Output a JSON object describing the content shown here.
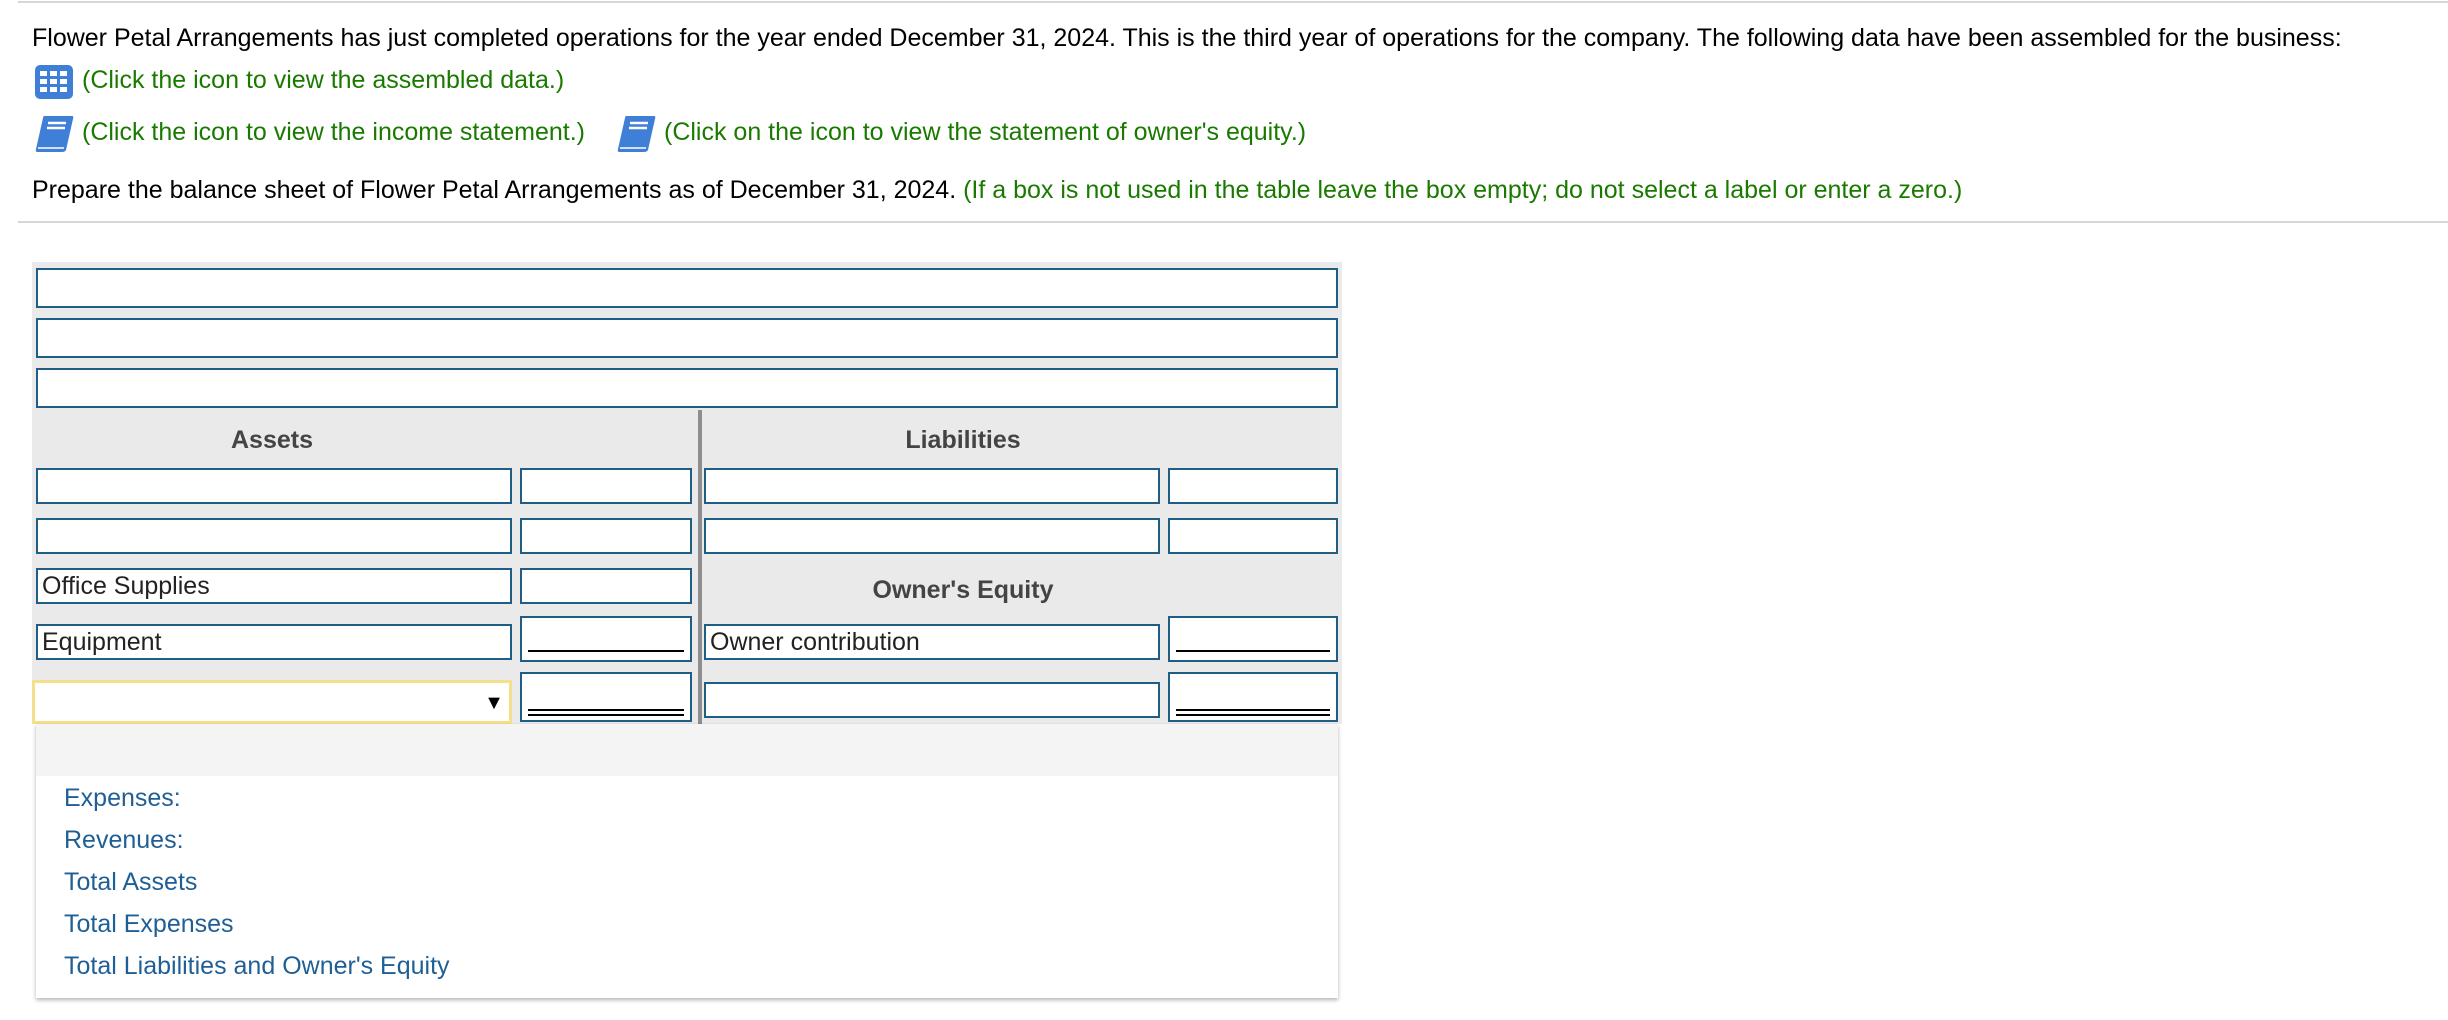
{
  "intro": {
    "text": "Flower Petal Arrangements has just completed operations for the year ended December 31, 2024. This is the third year of operations for the company. The following data have been assembled for the business:",
    "data_link": "(Click the icon to view the assembled data.)",
    "income_link": "(Click the icon to view the income statement.)",
    "equity_link": "(Click on the icon to view the statement of owner's equity.)"
  },
  "instruction": {
    "text": "Prepare the balance sheet of Flower Petal Arrangements as of December 31, 2024.",
    "note": "(If a box is not used in the table leave the box empty; do not select a label or enter a zero.)"
  },
  "table": {
    "header_rows": [
      "",
      "",
      ""
    ],
    "assets_header": "Assets",
    "liabilities_header": "Liabilities",
    "equity_header": "Owner's Equity",
    "assets": [
      {
        "label": "",
        "amount": ""
      },
      {
        "label": "",
        "amount": ""
      },
      {
        "label": "Office Supplies",
        "amount": ""
      },
      {
        "label": "Equipment",
        "amount": ""
      }
    ],
    "liabilities": [
      {
        "label": "",
        "amount": ""
      },
      {
        "label": "",
        "amount": ""
      }
    ],
    "equity": [
      {
        "label": "Owner contribution",
        "amount": ""
      },
      {
        "label": "",
        "amount": ""
      }
    ],
    "total_select": {
      "selected": "",
      "amount": ""
    }
  },
  "dropdown": {
    "options": [
      "",
      "Expenses:",
      "Revenues:",
      "Total Assets",
      "Total Expenses",
      "Total Liabilities and Owner's Equity"
    ]
  },
  "colors": {
    "link_green": "#1a7a00",
    "input_border": "#1f5f85",
    "option_blue": "#1f5f95",
    "icon_blue": "#3f7fd8"
  },
  "icons": {
    "data": "grid-icon",
    "income": "book-icon",
    "equity": "book-icon",
    "select": "triangle-down-icon"
  }
}
